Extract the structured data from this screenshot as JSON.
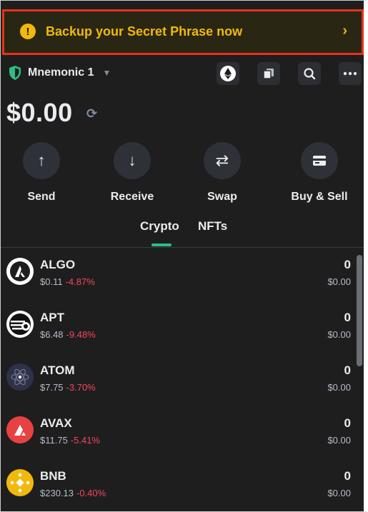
{
  "banner": {
    "text": "Backup your Secret Phrase now",
    "icon": "!",
    "chevron": "›"
  },
  "account": {
    "name": "Mnemonic 1"
  },
  "header_icons": [
    "ethereum-network-icon",
    "copy-icon",
    "search-icon",
    "more-icon"
  ],
  "balance": {
    "value": "$0.00"
  },
  "actions": [
    {
      "label": "Send",
      "icon": "↑"
    },
    {
      "label": "Receive",
      "icon": "↓"
    },
    {
      "label": "Swap",
      "icon": "⇄"
    },
    {
      "label": "Buy & Sell",
      "icon": "card"
    }
  ],
  "tabs": [
    {
      "label": "Crypto",
      "active": true
    },
    {
      "label": "NFTs",
      "active": false
    }
  ],
  "assets": [
    {
      "symbol": "ALGO",
      "price": "$0.11",
      "change": "-4.87%",
      "amount": "0",
      "value": "$0.00",
      "icon_color": "#ffffff"
    },
    {
      "symbol": "APT",
      "price": "$6.48",
      "change": "-9.48%",
      "amount": "0",
      "value": "$0.00",
      "icon_color": "#ffffff"
    },
    {
      "symbol": "ATOM",
      "price": "$7.75",
      "change": "-3.70%",
      "amount": "0",
      "value": "$0.00",
      "icon_color": "#2e3148"
    },
    {
      "symbol": "AVAX",
      "price": "$11.75",
      "change": "-5.41%",
      "amount": "0",
      "value": "$0.00",
      "icon_color": "#e84142"
    },
    {
      "symbol": "BNB",
      "price": "$230.13",
      "change": "-0.40%",
      "amount": "0",
      "value": "$0.00",
      "icon_color": "#f0b90b"
    }
  ],
  "colors": {
    "accent": "#f0b90b",
    "negative": "#f6465d",
    "positive": "#2ebd85",
    "background": "#1e1e1f"
  }
}
